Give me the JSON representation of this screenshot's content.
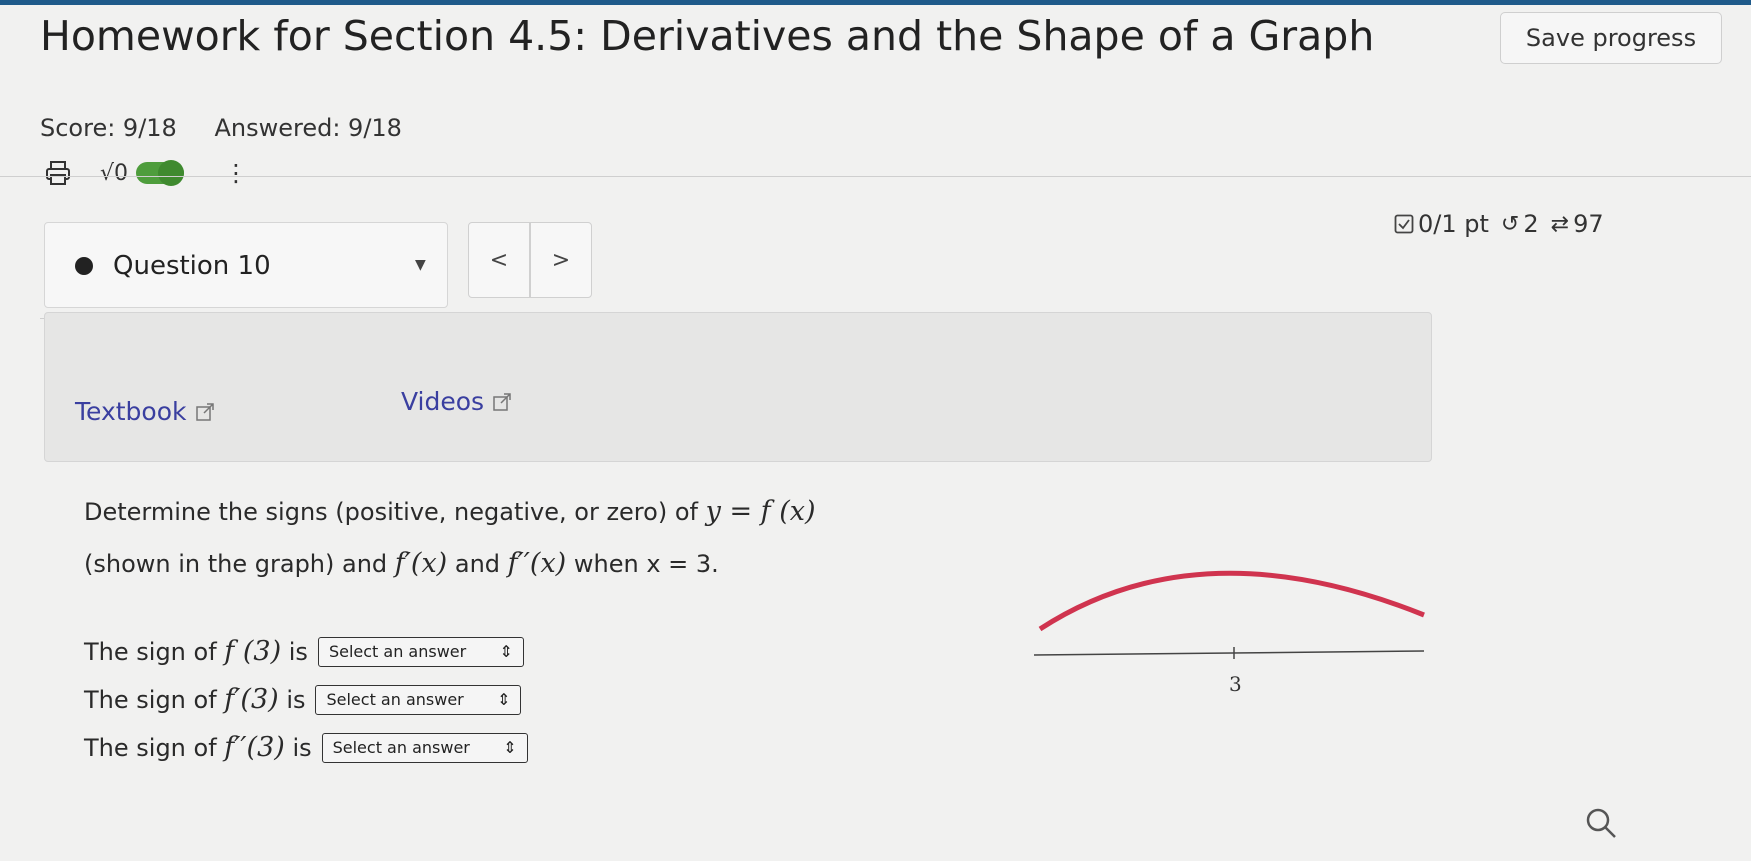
{
  "header": {
    "title": "Homework for Section 4.5: Derivatives and the Shape of a Graph",
    "save_label": "Save progress",
    "score": "Score: 9/18",
    "answered": "Answered: 9/18"
  },
  "toolbar": {
    "icons": [
      "print-icon",
      "sqrt-icon",
      "toggle-switch",
      "more-vertical-icon"
    ],
    "sqrt_label": "√0",
    "more_label": "⋮",
    "toggle_color": "#4e9d3c"
  },
  "question_nav": {
    "label": "Question 10",
    "prev_label": "<",
    "next_label": ">",
    "points": "0/1 pt",
    "retries": "2",
    "attempts": "97"
  },
  "resources": {
    "textbook": "Textbook",
    "videos": "Videos",
    "link_color": "#3a3fa0"
  },
  "problem": {
    "prompt_line1_pre": "Determine the signs (positive, negative, or zero) of",
    "prompt_line1_math": "y = f (x)",
    "prompt_line2_pre": "(shown in the graph) and",
    "prompt_line2_m1": "f′(x)",
    "prompt_line2_and": "and",
    "prompt_line2_m2": "f′′(x)",
    "prompt_line2_when": "when",
    "prompt_line2_cond": "x = 3.",
    "rows": [
      {
        "prefix": "The sign of",
        "expr": "f (3)",
        "suffix": "is",
        "select": "Select an answer"
      },
      {
        "prefix": "The sign of",
        "expr": "f′(3)",
        "suffix": "is",
        "select": "Select an answer"
      },
      {
        "prefix": "The sign of",
        "expr": "f′′(3)",
        "suffix": "is",
        "select": "Select an answer"
      }
    ]
  },
  "graph": {
    "tick_label": "3",
    "curve_color": "#d0344f"
  }
}
